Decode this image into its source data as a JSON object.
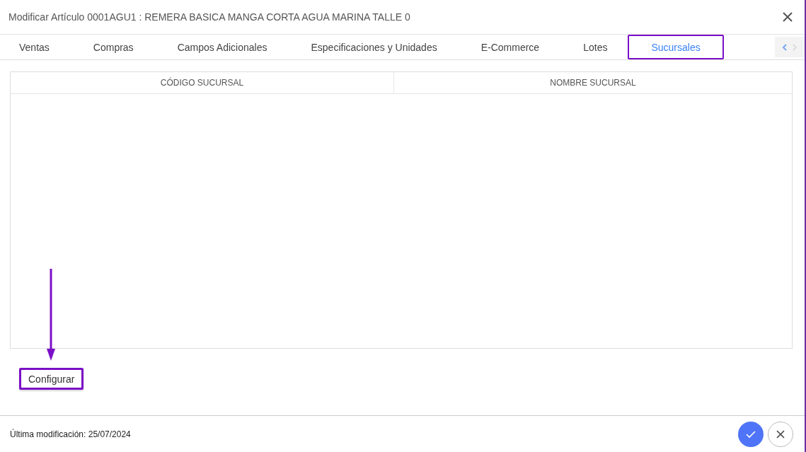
{
  "window": {
    "title": "Modificar Artículo 0001AGU1 : REMERA BASICA MANGA CORTA AGUA MARINA TALLE 0"
  },
  "tabs": [
    {
      "label": "Ventas",
      "selected": false,
      "highlighted": false
    },
    {
      "label": "Compras",
      "selected": false,
      "highlighted": false
    },
    {
      "label": "Campos Adicionales",
      "selected": false,
      "highlighted": false
    },
    {
      "label": "Especificaciones y Unidades",
      "selected": false,
      "highlighted": false
    },
    {
      "label": "E-Commerce",
      "selected": false,
      "highlighted": false
    },
    {
      "label": "Lotes",
      "selected": false,
      "highlighted": false
    },
    {
      "label": "Sucursales",
      "selected": true,
      "highlighted": true
    }
  ],
  "table": {
    "columns": [
      "CÓDIGO SUCURSAL",
      "NOMBRE SUCURSAL"
    ]
  },
  "configure_button": {
    "label": "Configurar",
    "highlighted": true
  },
  "status_bar": {
    "last_modified": "Última modificación: 25/07/2024"
  }
}
